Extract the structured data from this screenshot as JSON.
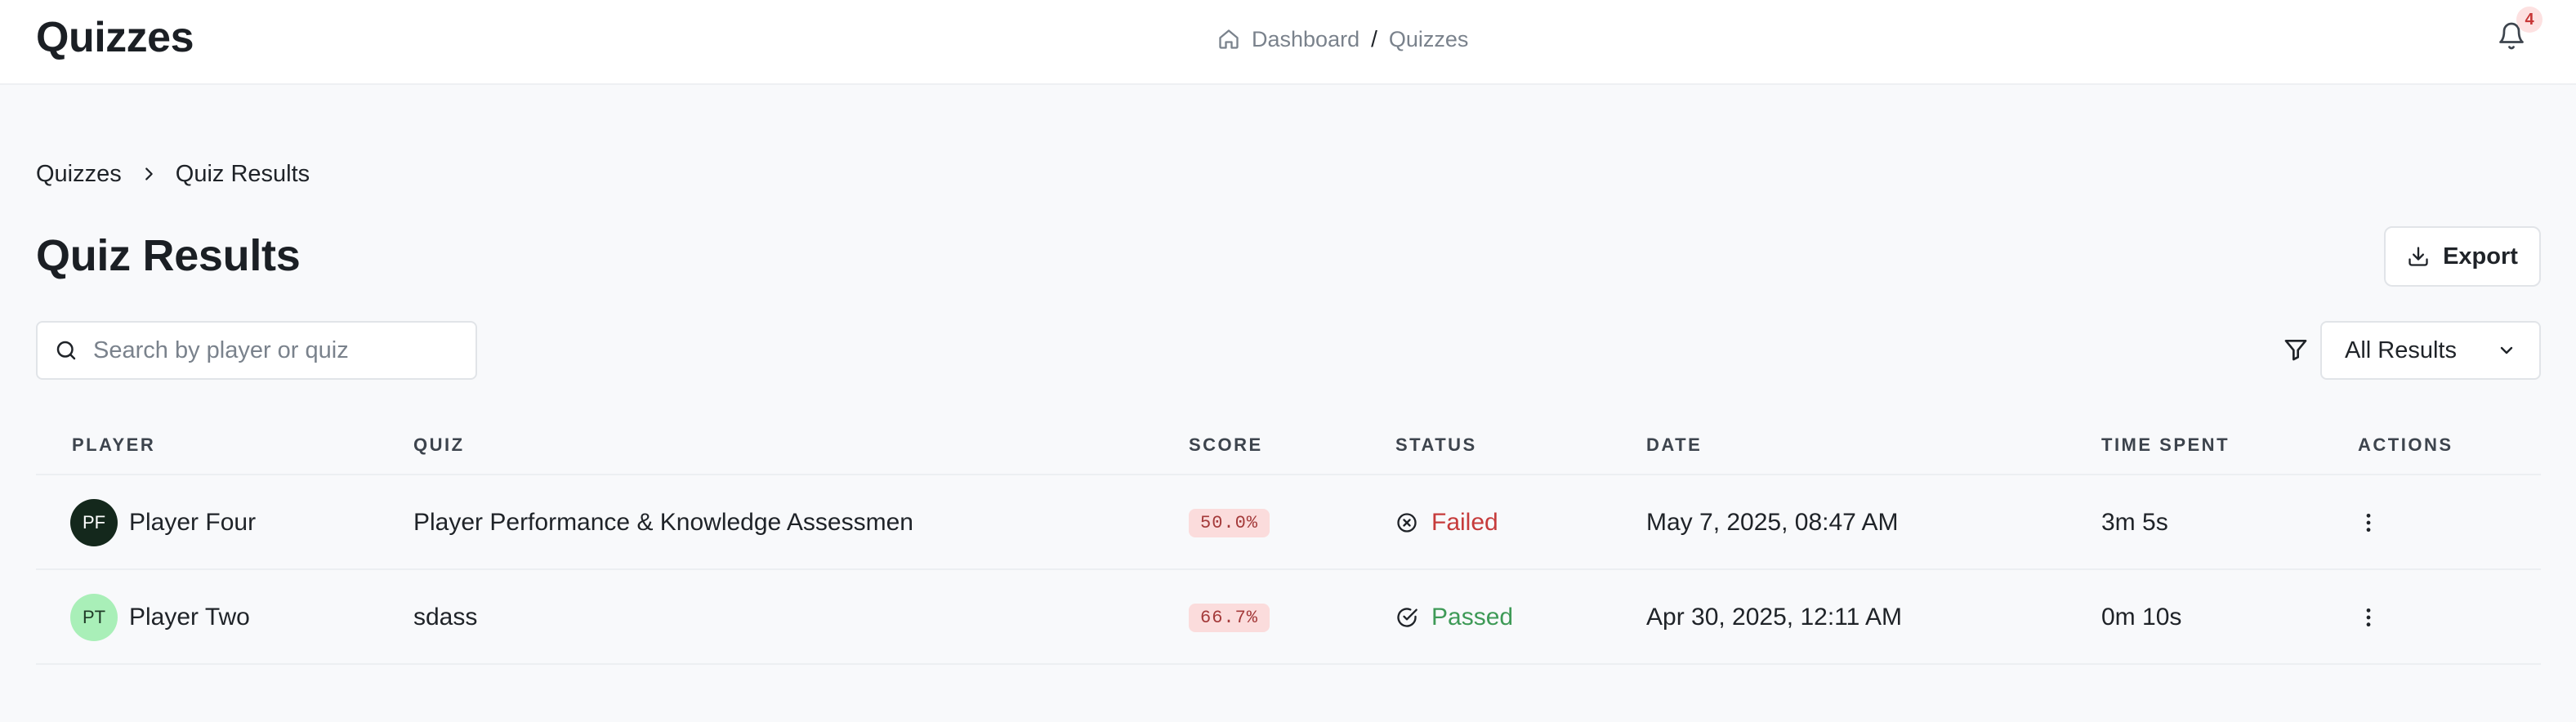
{
  "header": {
    "app_title": "Quizzes",
    "breadcrumb": {
      "home_label": "Dashboard",
      "separator": "/",
      "current": "Quizzes"
    },
    "notifications": {
      "count": "4"
    }
  },
  "breadcrumb": {
    "parent": "Quizzes",
    "current": "Quiz Results"
  },
  "page": {
    "title": "Quiz Results",
    "export_label": "Export"
  },
  "toolbar": {
    "search_placeholder": "Search by player or quiz",
    "filter_value": "All Results"
  },
  "table": {
    "columns": {
      "player": "PLAYER",
      "quiz": "QUIZ",
      "score": "SCORE",
      "status": "STATUS",
      "date": "DATE",
      "time_spent": "TIME SPENT",
      "actions": "ACTIONS"
    },
    "rows": [
      {
        "initials": "PF",
        "player": "Player Four",
        "quiz": "Player Performance & Knowledge Assessmen",
        "score": "50.0%",
        "status": "Failed",
        "date": "May 7, 2025, 08:47 AM",
        "time_spent": "3m 5s"
      },
      {
        "initials": "PT",
        "player": "Player Two",
        "quiz": "sdass",
        "score": "66.7%",
        "status": "Passed",
        "date": "Apr 30, 2025, 12:11 AM",
        "time_spent": "0m 10s"
      }
    ]
  },
  "colors": {
    "failed": "#c63b3b",
    "passed": "#3e9a57",
    "score_badge_bg": "#fbdcdc",
    "avatar_dark": "#14281c",
    "avatar_light": "#a9efb8"
  },
  "icons": [
    "home-icon",
    "bell-icon",
    "chevron-right-icon",
    "download-icon",
    "search-icon",
    "filter-icon",
    "chevron-down-icon",
    "x-circle-icon",
    "check-circle-icon",
    "more-vertical-icon"
  ]
}
